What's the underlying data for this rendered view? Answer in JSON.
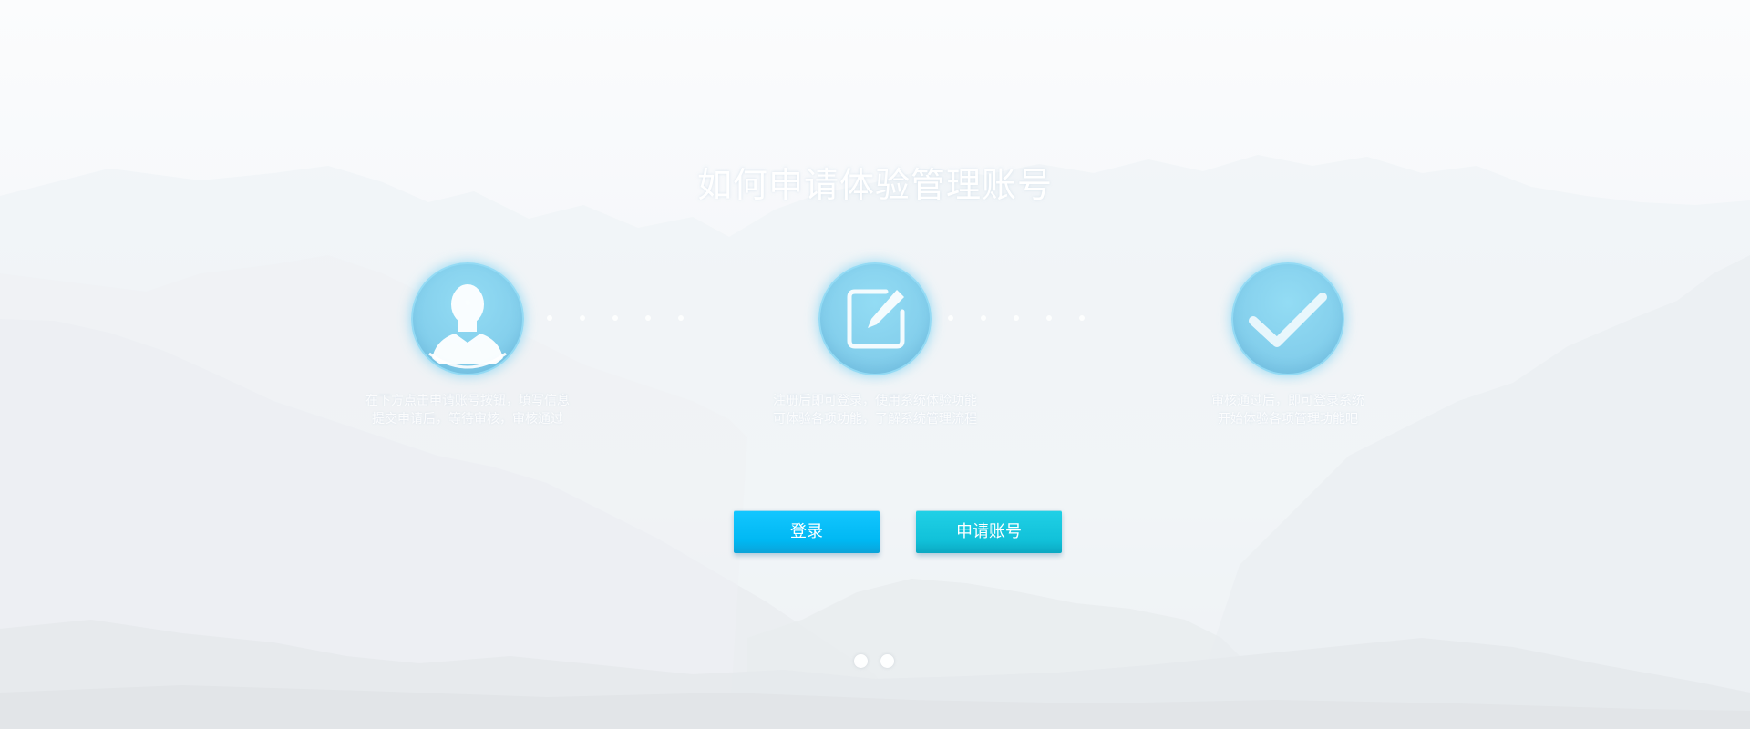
{
  "page": {
    "title": "如何申请体验管理账号"
  },
  "steps": [
    {
      "icon": "user-icon",
      "desc_line1": "在下方点击申请账号按钮，填写信息",
      "desc_line2": "提交申请后，等待审核，审核通过"
    },
    {
      "icon": "edit-icon",
      "desc_line1": "注册后即可登录，使用系统体验功能",
      "desc_line2": "可体验各项功能，了解系统管理流程"
    },
    {
      "icon": "check-icon",
      "desc_line1": "审核通过后，即可登录系统",
      "desc_line2": "开始体验各项管理功能吧"
    }
  ],
  "buttons": {
    "login_label": "登录",
    "apply_label": "申请账号"
  },
  "colors": {
    "login_button": "#00b8f3",
    "apply_button": "#11c1d9",
    "icon_circle": "#84cfec"
  },
  "pager": {
    "count": 2,
    "active": 1
  }
}
